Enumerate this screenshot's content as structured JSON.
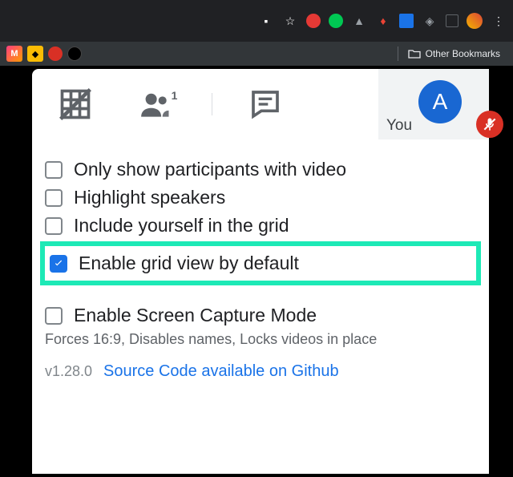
{
  "bookmarks": {
    "other_label": "Other Bookmarks"
  },
  "meet": {
    "you_label": "You",
    "avatar_initial": "A",
    "options": [
      {
        "label": "Only show participants with video",
        "checked": false
      },
      {
        "label": "Highlight speakers",
        "checked": false
      },
      {
        "label": "Include yourself in the grid",
        "checked": false
      },
      {
        "label": "Enable grid view by default",
        "checked": true,
        "highlighted": true
      },
      {
        "label": "Enable Screen Capture Mode",
        "checked": false,
        "spacer_before": true
      }
    ],
    "subtitle": "Forces 16:9, Disables names, Locks videos in place",
    "version": "v1.28.0",
    "source_link": "Source Code available on Github"
  }
}
